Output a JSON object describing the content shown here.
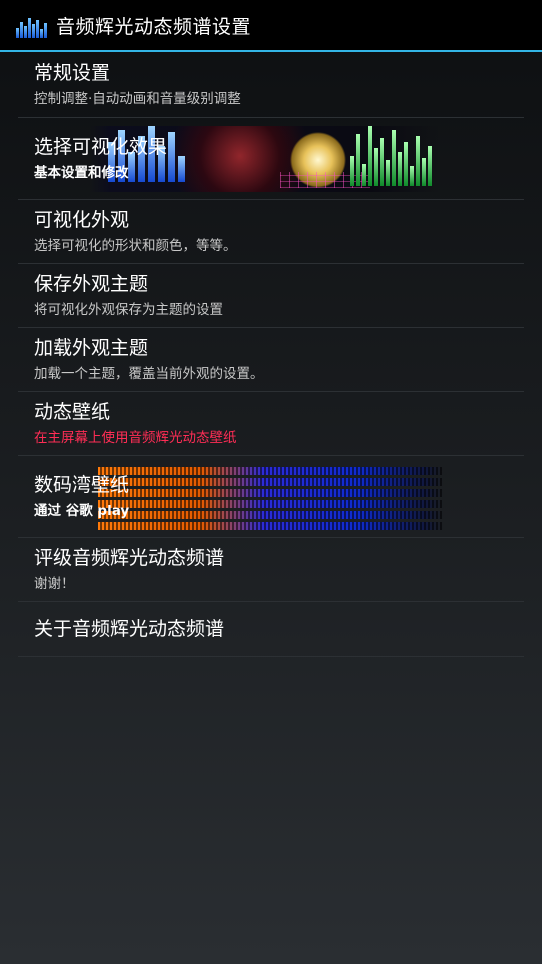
{
  "header": {
    "title": "音频辉光动态频谱设置",
    "icon": "equalizer-bars-icon",
    "accent": "#33b5e5"
  },
  "items": [
    {
      "title": "常规设置",
      "subtitle": "控制调整·自动动画和音量级别调整"
    },
    {
      "title": "选择可视化效果",
      "subtitle": "基本设置和修改"
    },
    {
      "title": "可视化外观",
      "subtitle": "选择可视化的形状和颜色，等等。"
    },
    {
      "title": "保存外观主题",
      "subtitle": "将可视化外观保存为主题的设置"
    },
    {
      "title": "加载外观主题",
      "subtitle": "加载一个主题，覆盖当前外观的设置。"
    },
    {
      "title": "动态壁纸",
      "subtitle": "在主屏幕上使用音频辉光动态壁纸",
      "subtitle_color": "#ff2d55"
    },
    {
      "title": "数码湾壁纸",
      "subtitle": "通过 谷歌 play"
    },
    {
      "title": "评级音频辉光动态频谱",
      "subtitle": "谢谢！"
    },
    {
      "title": "关于音频辉光动态频谱"
    }
  ]
}
